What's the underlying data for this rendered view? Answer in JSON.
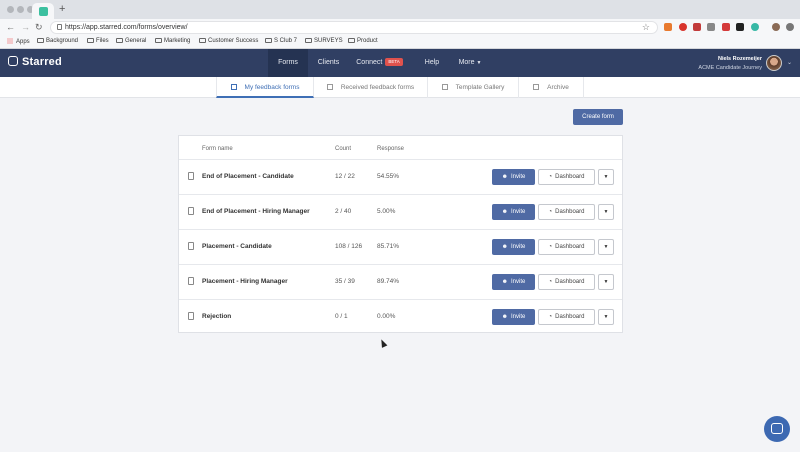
{
  "browser": {
    "url": "https://app.starred.com/forms/overview/",
    "new_tab_label": "+",
    "bookmarks": [
      {
        "label": "Apps"
      },
      {
        "label": "Background"
      },
      {
        "label": "Files"
      },
      {
        "label": "General"
      },
      {
        "label": "Marketing"
      },
      {
        "label": "Customer Success"
      },
      {
        "label": "S Club 7"
      },
      {
        "label": "SURVEYS"
      },
      {
        "label": "Product"
      }
    ]
  },
  "app": {
    "logo": "Starred",
    "nav": [
      {
        "label": "Forms"
      },
      {
        "label": "Clients"
      },
      {
        "label": "Connect",
        "badge": "BETA"
      },
      {
        "label": "Help"
      },
      {
        "label": "More"
      }
    ],
    "user": {
      "name": "Niels Rozemeijer",
      "org": "ACME Candidate Journey"
    }
  },
  "subnav": [
    {
      "label": "My feedback forms"
    },
    {
      "label": "Received feedback forms"
    },
    {
      "label": "Template Gallery"
    },
    {
      "label": "Archive"
    }
  ],
  "actions": {
    "create_form": "Create form"
  },
  "table": {
    "headers": {
      "name": "Form name",
      "count": "Count",
      "response": "Response"
    },
    "rows": [
      {
        "name": "End of Placement - Candidate",
        "count": "12 / 22",
        "response": "54.55%"
      },
      {
        "name": "End of Placement - Hiring Manager",
        "count": "2 / 40",
        "response": "5.00%"
      },
      {
        "name": "Placement - Candidate",
        "count": "108 / 126",
        "response": "85.71%"
      },
      {
        "name": "Placement - Hiring Manager",
        "count": "35 / 39",
        "response": "89.74%"
      },
      {
        "name": "Rejection",
        "count": "0 / 1",
        "response": "0.00%"
      }
    ],
    "invite_label": "Invite",
    "dashboard_label": "Dashboard"
  }
}
